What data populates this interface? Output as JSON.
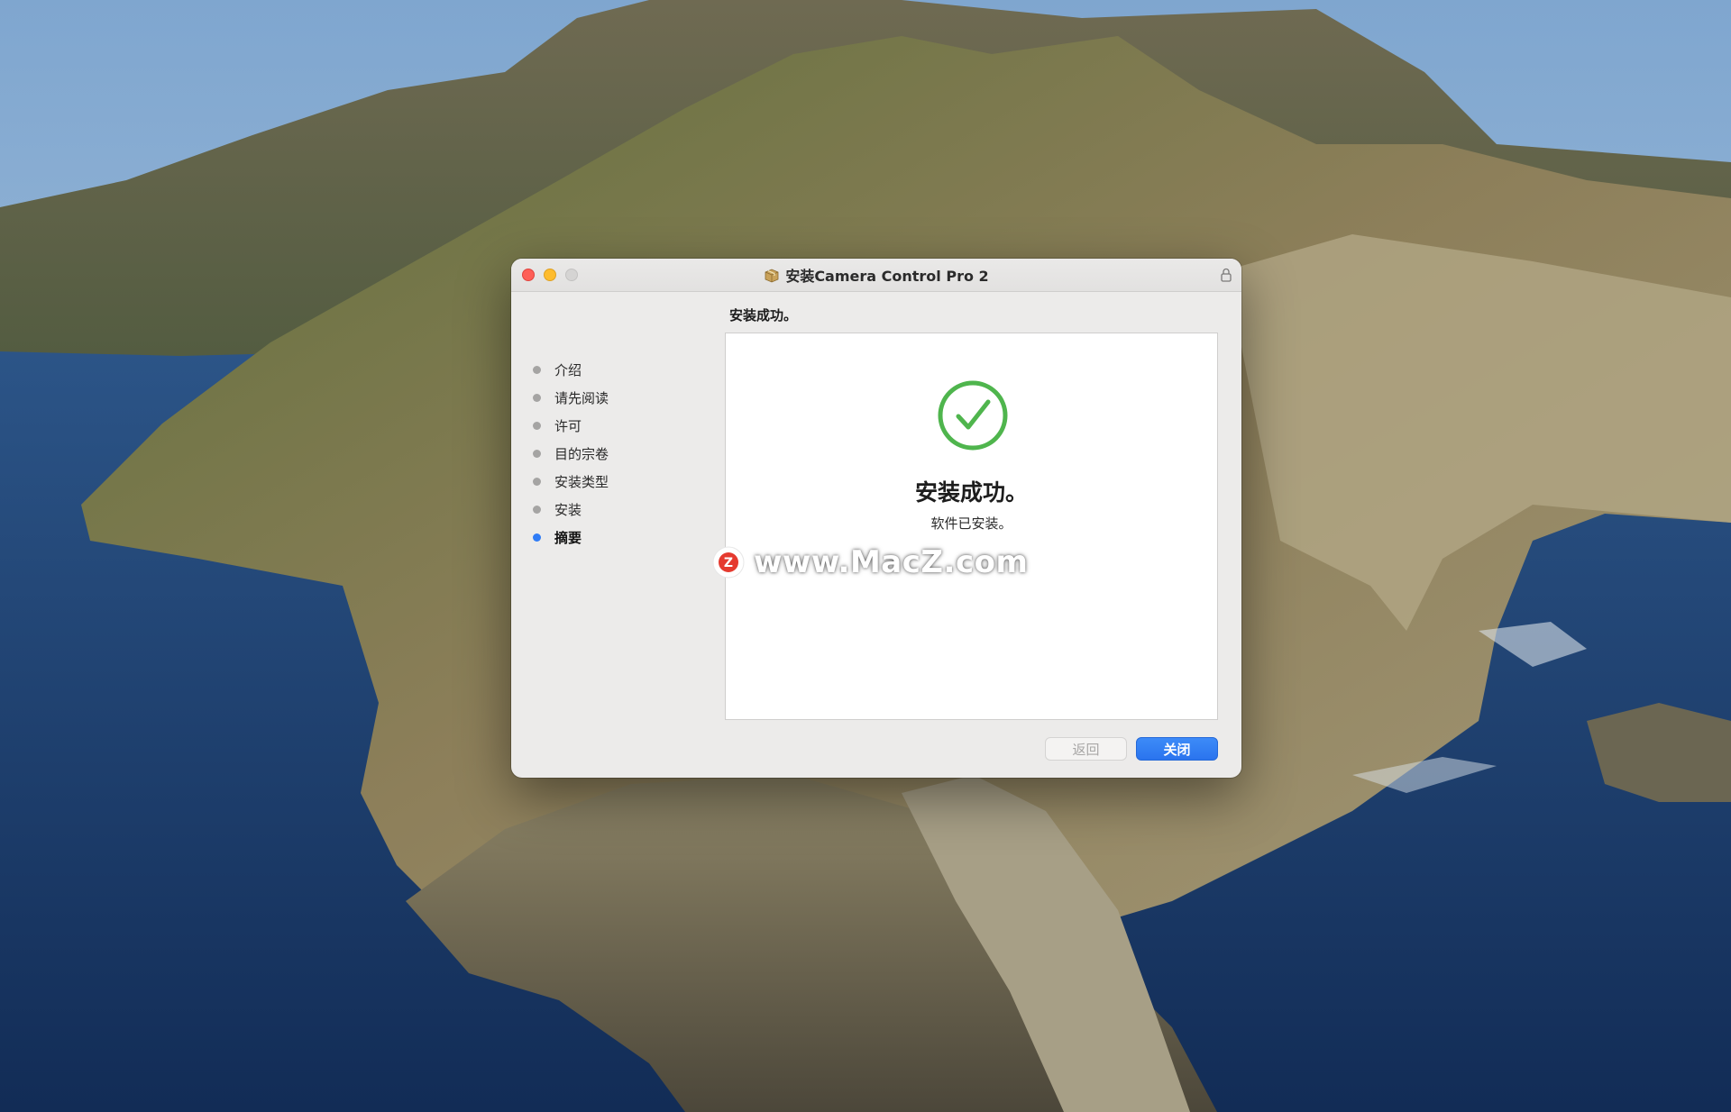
{
  "window": {
    "title": "安装Camera Control Pro 2",
    "heading": "安装成功。"
  },
  "sidebar": {
    "steps": [
      {
        "label": "介绍",
        "active": false
      },
      {
        "label": "请先阅读",
        "active": false
      },
      {
        "label": "许可",
        "active": false
      },
      {
        "label": "目的宗卷",
        "active": false
      },
      {
        "label": "安装类型",
        "active": false
      },
      {
        "label": "安装",
        "active": false
      },
      {
        "label": "摘要",
        "active": true
      }
    ]
  },
  "content": {
    "success_title": "安装成功。",
    "success_subtitle": "软件已安装。",
    "watermark": "www.MacZ.com",
    "watermark_logo_letter": "Z"
  },
  "buttons": {
    "back_label": "返回",
    "close_label": "关闭"
  },
  "colors": {
    "accent": "#2f7cf6",
    "success_green": "#4fb54d",
    "close_light": "#fe5f57",
    "minimize_light": "#febc2e",
    "zoom_light": "#d5d4d3"
  }
}
